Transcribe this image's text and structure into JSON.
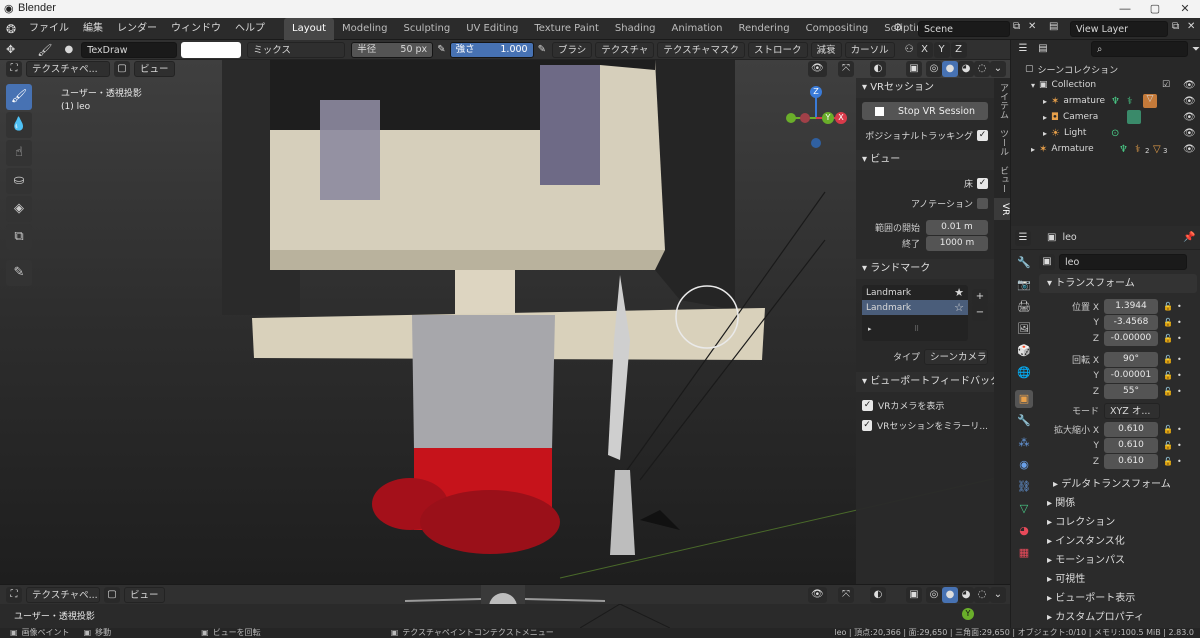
{
  "window": {
    "title": "Blender",
    "minimize": "—",
    "maximize": "▢",
    "close": "✕"
  },
  "menu": {
    "items": [
      "ファイル",
      "編集",
      "レンダー",
      "ウィンドウ",
      "ヘルプ"
    ],
    "workspaces": [
      "Layout",
      "Modeling",
      "Sculpting",
      "UV Editing",
      "Texture Paint",
      "Shading",
      "Animation",
      "Rendering",
      "Compositing",
      "Scripting"
    ],
    "add_tab": "+",
    "scene": "Scene",
    "view_layer": "View Layer"
  },
  "toolsettings": {
    "brush": "TexDraw",
    "blend": "ミックス",
    "radius_label": "半径",
    "radius_value": "50 px",
    "strength_label": "強さ",
    "strength_value": "1.000",
    "menus": [
      "ブラシ",
      "テクスチャ",
      "テクスチャマスク",
      "ストローク",
      "減衰",
      "カーソル"
    ],
    "axes": [
      "X",
      "Y",
      "Z"
    ]
  },
  "viewport": {
    "mode": "テクスチャペ...",
    "view": "ビュー",
    "overlay_title": "ユーザー・透視投影",
    "object_info": "(1) leo",
    "gizmo_axes": {
      "x": "X",
      "y": "Y",
      "z": "Z"
    }
  },
  "npanel": {
    "tabs": [
      "アイテム",
      "ツール",
      "ビュー",
      "VR"
    ],
    "vr_session": {
      "header": "VRセッション",
      "button": "Stop VR Session",
      "positional_tracking": "ポジショナルトラッキング"
    },
    "view": {
      "header": "ビュー",
      "floor": "床",
      "annotations": "アノテーション",
      "clip_start_label": "範囲の開始",
      "clip_start": "0.01 m",
      "clip_end_label": "終了",
      "clip_end": "1000 m"
    },
    "landmarks": {
      "header": "ランドマーク",
      "items": [
        "Landmark",
        "Landmark"
      ],
      "type_label": "タイプ",
      "type_value": "シーンカメラ"
    },
    "feedback": {
      "header": "ビューポートフィードバック",
      "vr_camera": "VRカメラを表示",
      "mirror": "VRセッションをミラーリ..."
    }
  },
  "outliner": {
    "root": "シーンコレクション",
    "items": [
      {
        "name": "Collection",
        "icon": "collection-icon"
      },
      {
        "name": "armature",
        "icon": "armature-icon"
      },
      {
        "name": "Camera",
        "icon": "camera-icon"
      },
      {
        "name": "Light",
        "icon": "light-icon"
      },
      {
        "name": "Armature",
        "icon": "armature-icon"
      }
    ],
    "badges": {
      "armature_pose_count": "2",
      "armature_constraint_count": "3"
    }
  },
  "properties": {
    "object_name": "leo",
    "header_object": "leo",
    "transform": {
      "header": "トランスフォーム",
      "location_label": "位置",
      "location": [
        "1.3944",
        "-3.4568",
        "-0.00000"
      ],
      "rotation_label": "回転",
      "rotation": [
        "90°",
        "-0.00001",
        "55°"
      ],
      "mode_label": "モード",
      "mode": "XYZ オ...",
      "scale_label": "拡大縮小",
      "scale": [
        "0.610",
        "0.610",
        "0.610"
      ],
      "axis": [
        "X",
        "Y",
        "Z"
      ]
    },
    "delta": "デルタトランスフォーム",
    "sections": [
      "関係",
      "コレクション",
      "インスタンス化",
      "モーションパス",
      "可視性",
      "ビューポート表示",
      "カスタムプロパティ"
    ]
  },
  "bottom": {
    "mode": "テクスチャペ...",
    "view": "ビュー",
    "overlay_title": "ユーザー・透視投影",
    "gizmo_y": "Y"
  },
  "status": {
    "left": "画像ペイント",
    "move": "移動",
    "rotate": "ビューを回転",
    "context": "テクスチャペイントコンテクストメニュー",
    "stats": "leo | 頂点:20,366 | 面:29,650 | 三角面:29,650 | オブジェクト:0/10 | メモリ:100.5 MiB | 2.83.0"
  }
}
